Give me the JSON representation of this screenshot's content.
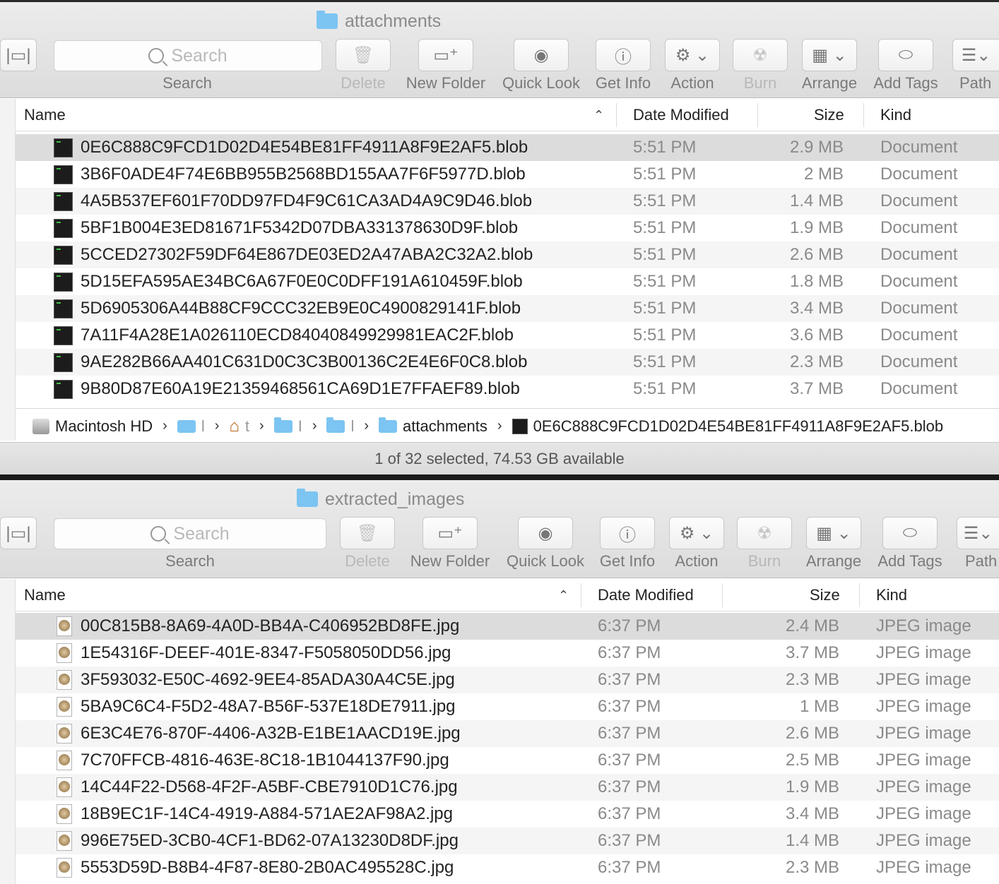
{
  "windows": [
    {
      "title": "attachments",
      "toolbar": {
        "view_button": "view-switcher",
        "search_placeholder": "Search",
        "search_label": "Search",
        "buttons": [
          "Delete",
          "New Folder",
          "Quick Look",
          "Get Info",
          "Action",
          "Burn",
          "Arrange",
          "Add Tags",
          "Path"
        ]
      },
      "columns": {
        "name": "Name",
        "date": "Date Modified",
        "size": "Size",
        "kind": "Kind"
      },
      "rows": [
        {
          "name": "0E6C888C9FCD1D02D4E54BE81FF4911A8F9E2AF5.blob",
          "date": "5:51 PM",
          "size": "2.9 MB",
          "kind": "Document"
        },
        {
          "name": "3B6F0ADE4F74E6BB955B2568BD155AA7F6F5977D.blob",
          "date": "5:51 PM",
          "size": "2 MB",
          "kind": "Document"
        },
        {
          "name": "4A5B537EF601F70DD97FD4F9C61CA3AD4A9C9D46.blob",
          "date": "5:51 PM",
          "size": "1.4 MB",
          "kind": "Document"
        },
        {
          "name": "5BF1B004E3ED81671F5342D07DBA331378630D9F.blob",
          "date": "5:51 PM",
          "size": "1.9 MB",
          "kind": "Document"
        },
        {
          "name": "5CCED27302F59DF64E867DE03ED2A47ABA2C32A2.blob",
          "date": "5:51 PM",
          "size": "2.6 MB",
          "kind": "Document"
        },
        {
          "name": "5D15EFA595AE34BC6A67F0E0C0DFF191A610459F.blob",
          "date": "5:51 PM",
          "size": "1.8 MB",
          "kind": "Document"
        },
        {
          "name": "5D6905306A44B88CF9CCC32EB9E0C4900829141F.blob",
          "date": "5:51 PM",
          "size": "3.4 MB",
          "kind": "Document"
        },
        {
          "name": "7A11F4A28E1A026110ECD84040849929981EAC2F.blob",
          "date": "5:51 PM",
          "size": "3.6 MB",
          "kind": "Document"
        },
        {
          "name": "9AE282B66AA401C631D0C3C3B00136C2E4E6F0C8.blob",
          "date": "5:51 PM",
          "size": "2.3 MB",
          "kind": "Document"
        },
        {
          "name": "9B80D87E60A19E21359468561CA69D1E7FFAEF89.blob",
          "date": "5:51 PM",
          "size": "3.7 MB",
          "kind": "Document"
        }
      ],
      "pathbar": {
        "root": "Macintosh HD",
        "segments": [
          "l",
          "t",
          "I",
          "l"
        ],
        "folder": "attachments",
        "file": "0E6C888C9FCD1D02D4E54BE81FF4911A8F9E2AF5.blob"
      },
      "status": "1 of 32 selected, 74.53 GB available"
    },
    {
      "title": "extracted_images",
      "toolbar": {
        "view_button": "view-switcher",
        "search_placeholder": "Search",
        "search_label": "Search",
        "buttons": [
          "Delete",
          "New Folder",
          "Quick Look",
          "Get Info",
          "Action",
          "Burn",
          "Arrange",
          "Add Tags",
          "Path"
        ]
      },
      "columns": {
        "name": "Name",
        "date": "Date Modified",
        "size": "Size",
        "kind": "Kind"
      },
      "rows": [
        {
          "name": "00C815B8-8A69-4A0D-BB4A-C406952BD8FE.jpg",
          "date": "6:37 PM",
          "size": "2.4 MB",
          "kind": "JPEG image"
        },
        {
          "name": "1E54316F-DEEF-401E-8347-F5058050DD56.jpg",
          "date": "6:37 PM",
          "size": "3.7 MB",
          "kind": "JPEG image"
        },
        {
          "name": "3F593032-E50C-4692-9EE4-85ADA30A4C5E.jpg",
          "date": "6:37 PM",
          "size": "2.3 MB",
          "kind": "JPEG image"
        },
        {
          "name": "5BA9C6C4-F5D2-48A7-B56F-537E18DE7911.jpg",
          "date": "6:37 PM",
          "size": "1 MB",
          "kind": "JPEG image"
        },
        {
          "name": "6E3C4E76-870F-4406-A32B-E1BE1AACD19E.jpg",
          "date": "6:37 PM",
          "size": "2.6 MB",
          "kind": "JPEG image"
        },
        {
          "name": "7C70FFCB-4816-463E-8C18-1B1044137F90.jpg",
          "date": "6:37 PM",
          "size": "2.5 MB",
          "kind": "JPEG image"
        },
        {
          "name": "14C44F22-D568-4F2F-A5BF-CBE7910D1C76.jpg",
          "date": "6:37 PM",
          "size": "1.9 MB",
          "kind": "JPEG image"
        },
        {
          "name": "18B9EC1F-14C4-4919-A884-571AE2AF98A2.jpg",
          "date": "6:37 PM",
          "size": "3.4 MB",
          "kind": "JPEG image"
        },
        {
          "name": "996E75ED-3CB0-4CF1-BD62-07A13230D8DF.jpg",
          "date": "6:37 PM",
          "size": "1.4 MB",
          "kind": "JPEG image"
        },
        {
          "name": "5553D59D-B8B4-4F87-8E80-2B0AC495528C.jpg",
          "date": "6:37 PM",
          "size": "2.3 MB",
          "kind": "JPEG image"
        }
      ]
    }
  ],
  "colors": {
    "selection": "#dcdcdc",
    "folder": "#7cc4f2",
    "toolbar": "#e4e4e4"
  },
  "icons": {
    "toolbar": [
      "view-switcher-icon",
      "search-icon",
      "trash-icon",
      "new-folder-icon",
      "eye-icon",
      "info-icon",
      "gear-icon",
      "burn-icon",
      "arrange-icon",
      "tag-icon",
      "path-icon"
    ],
    "sort": "sort-ascending-icon"
  }
}
